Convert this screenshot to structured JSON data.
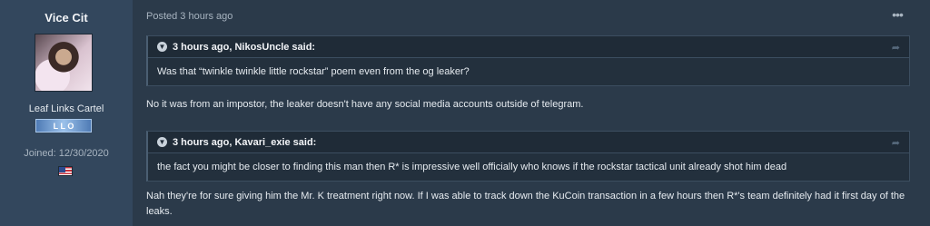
{
  "author": {
    "name": "Vice Cit",
    "group": "Leaf Links Cartel",
    "rank_badge": "L L O",
    "joined": "Joined: 12/30/2020"
  },
  "post": {
    "meta": "Posted 3 hours ago",
    "more_icon": "•••",
    "quotes": [
      {
        "header": "3 hours ago, NikosUncle said:",
        "body": "Was that “twinkle twinkle little rockstar” poem even from the og leaker?"
      },
      {
        "header": "3 hours ago, Kavari_exie said:",
        "body": "the fact you might be closer to finding this man then R* is impressive well officially who knows if the rockstar tactical unit already shot him dead"
      }
    ],
    "replies": [
      "No it was from an impostor, the leaker doesn't have any social media accounts outside of telegram.",
      "Nah they're for sure giving him the Mr. K treatment right now. If I was able to track down the KuCoin transaction in a few hours then R*'s team definitely had it first day of the leaks."
    ]
  },
  "icons": {
    "quote_toggle": "chevron-down-icon",
    "quote_share": "share-arrow-icon",
    "flag": "us-flag-icon"
  }
}
